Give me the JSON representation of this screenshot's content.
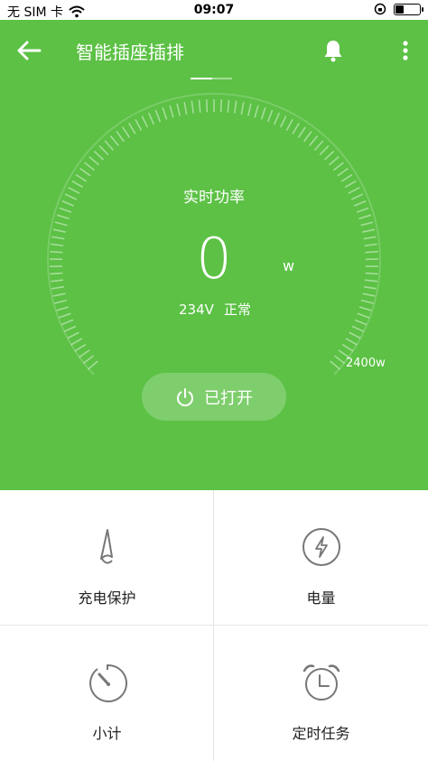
{
  "status_bar": {
    "carrier": "无 SIM 卡",
    "time": "09:07",
    "icons": [
      "wifi-icon",
      "orientation-lock-icon",
      "battery-icon"
    ]
  },
  "header": {
    "title": "智能插座插排",
    "back_icon": "arrow-left-icon",
    "bell_icon": "bell-icon",
    "more_icon": "more-vertical-icon"
  },
  "gauge": {
    "label": "实时功率",
    "value": "0",
    "unit": "w",
    "voltage": "234V",
    "state": "正常",
    "max_label": "2400w",
    "level_fraction": 0
  },
  "toggle": {
    "label": "已打开",
    "icon": "power-icon"
  },
  "features": [
    {
      "label": "充电保护",
      "icon": "charging-protection-icon"
    },
    {
      "label": "电量",
      "icon": "lightning-icon"
    },
    {
      "label": "小计",
      "icon": "timer-gauge-icon"
    },
    {
      "label": "定时任务",
      "icon": "alarm-clock-icon"
    }
  ],
  "colors": {
    "primary_green": "#5cc145",
    "white": "#ffffff",
    "icon_gray": "#777777"
  }
}
